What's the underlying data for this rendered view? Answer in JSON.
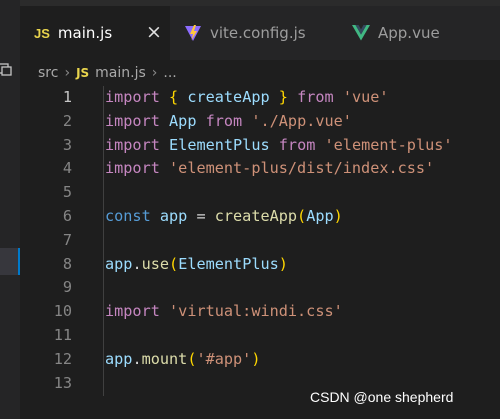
{
  "tabs": [
    {
      "icon": "js-icon",
      "icon_text": "JS",
      "label": "main.js",
      "active": true,
      "close": "×"
    },
    {
      "icon": "vite-icon",
      "label": "vite.config.js",
      "active": false
    },
    {
      "icon": "vue-icon",
      "label": "App.vue",
      "active": false
    }
  ],
  "breadcrumb": {
    "folder": "src",
    "sep1": "›",
    "file_icon_text": "JS",
    "file": "main.js",
    "sep2": "›",
    "more": "..."
  },
  "current_line": 1,
  "lines": [
    {
      "n": "1",
      "tokens": [
        {
          "t": "import",
          "c": "kw"
        },
        {
          "t": " "
        },
        {
          "t": "{",
          "c": "br"
        },
        {
          "t": " "
        },
        {
          "t": "createApp",
          "c": "var"
        },
        {
          "t": " "
        },
        {
          "t": "}",
          "c": "br"
        },
        {
          "t": " "
        },
        {
          "t": "from",
          "c": "kw"
        },
        {
          "t": " "
        },
        {
          "t": "'vue'",
          "c": "str"
        }
      ]
    },
    {
      "n": "2",
      "tokens": [
        {
          "t": "import",
          "c": "kw"
        },
        {
          "t": " "
        },
        {
          "t": "App",
          "c": "var"
        },
        {
          "t": " "
        },
        {
          "t": "from",
          "c": "kw"
        },
        {
          "t": " "
        },
        {
          "t": "'./App.vue'",
          "c": "str"
        }
      ]
    },
    {
      "n": "3",
      "tokens": [
        {
          "t": "import",
          "c": "kw"
        },
        {
          "t": " "
        },
        {
          "t": "ElementPlus",
          "c": "var"
        },
        {
          "t": " "
        },
        {
          "t": "from",
          "c": "kw"
        },
        {
          "t": " "
        },
        {
          "t": "'element-plus'",
          "c": "str"
        }
      ]
    },
    {
      "n": "4",
      "tokens": [
        {
          "t": "import",
          "c": "kw"
        },
        {
          "t": " "
        },
        {
          "t": "'element-plus/dist/index.css'",
          "c": "str"
        }
      ]
    },
    {
      "n": "5",
      "tokens": []
    },
    {
      "n": "6",
      "tokens": [
        {
          "t": "const",
          "c": "bl"
        },
        {
          "t": " "
        },
        {
          "t": "app",
          "c": "var"
        },
        {
          "t": " = "
        },
        {
          "t": "createApp",
          "c": "fn"
        },
        {
          "t": "(",
          "c": "br"
        },
        {
          "t": "App",
          "c": "var"
        },
        {
          "t": ")",
          "c": "br"
        }
      ]
    },
    {
      "n": "7",
      "tokens": []
    },
    {
      "n": "8",
      "tokens": [
        {
          "t": "app",
          "c": "var"
        },
        {
          "t": "."
        },
        {
          "t": "use",
          "c": "fn"
        },
        {
          "t": "(",
          "c": "br"
        },
        {
          "t": "ElementPlus",
          "c": "var"
        },
        {
          "t": ")",
          "c": "br"
        }
      ]
    },
    {
      "n": "9",
      "tokens": []
    },
    {
      "n": "10",
      "tokens": [
        {
          "t": "import",
          "c": "kw"
        },
        {
          "t": " "
        },
        {
          "t": "'virtual:windi.css'",
          "c": "str"
        }
      ]
    },
    {
      "n": "11",
      "tokens": []
    },
    {
      "n": "12",
      "tokens": [
        {
          "t": "app",
          "c": "var"
        },
        {
          "t": "."
        },
        {
          "t": "mount",
          "c": "fn"
        },
        {
          "t": "(",
          "c": "br"
        },
        {
          "t": "'#app'",
          "c": "str"
        },
        {
          "t": ")",
          "c": "br"
        }
      ]
    },
    {
      "n": "13",
      "tokens": []
    }
  ],
  "watermark": "CSDN @one shepherd",
  "colors": {
    "editor_bg": "#1e1e1e",
    "keyword": "#c586c0",
    "storage": "#569cd6",
    "function": "#dcdcaa",
    "variable": "#9cdcfe",
    "string": "#ce9178",
    "bracket": "#ffd700",
    "js_badge": "#e8d44d",
    "vue_green": "#41b883"
  }
}
